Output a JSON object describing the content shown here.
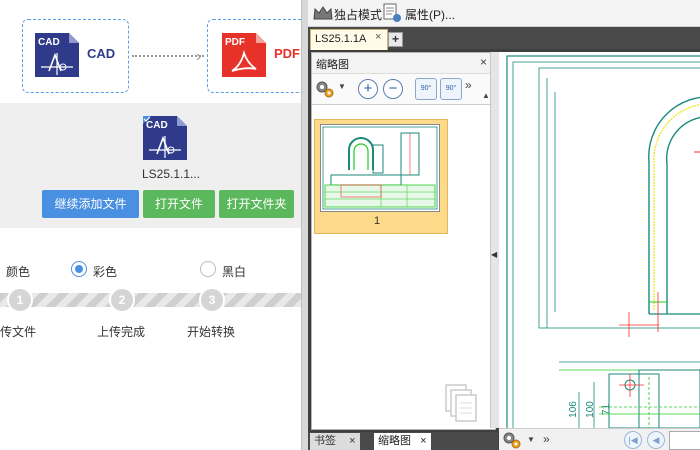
{
  "converter": {
    "source_format": "CAD",
    "target_format": "PDF",
    "file_icon_label": "CAD",
    "file_name": "LS25.1.1...",
    "buttons": {
      "add_more": "继续添加文件",
      "open_file": "打开文件",
      "open_folder": "打开文件夹"
    },
    "color": {
      "label": "颜色",
      "options": [
        "彩色",
        "黑白"
      ],
      "selected": "彩色"
    },
    "steps": [
      {
        "num": "1",
        "label": "传文件"
      },
      {
        "num": "2",
        "label": "上传完成"
      },
      {
        "num": "3",
        "label": "开始转换"
      }
    ],
    "colors": {
      "accent_blue": "#4a90e2",
      "green": "#5cb85c",
      "cad_navy": "#2f3b8a",
      "pdf_red": "#e63228"
    }
  },
  "viewer": {
    "toolbar": {
      "exclusive_mode": "独占模式",
      "properties": "属性(P)..."
    },
    "doc_tab": "LS25.1.1A",
    "thumbnail_panel": {
      "title": "缩略图",
      "zoom_in": "+",
      "zoom_out": "−",
      "rotate_left": "90°",
      "rotate_right": "90°",
      "page_number": "1"
    },
    "bottom_tabs": [
      "书签",
      "缩略图"
    ],
    "drawing_dims": [
      "106",
      "100",
      "71"
    ],
    "colors": {
      "drawing_line": "#1a8a7a",
      "drawing_green": "#22cc22",
      "drawing_red": "#ff2a2a",
      "drawing_yellow": "#e6e600"
    }
  }
}
